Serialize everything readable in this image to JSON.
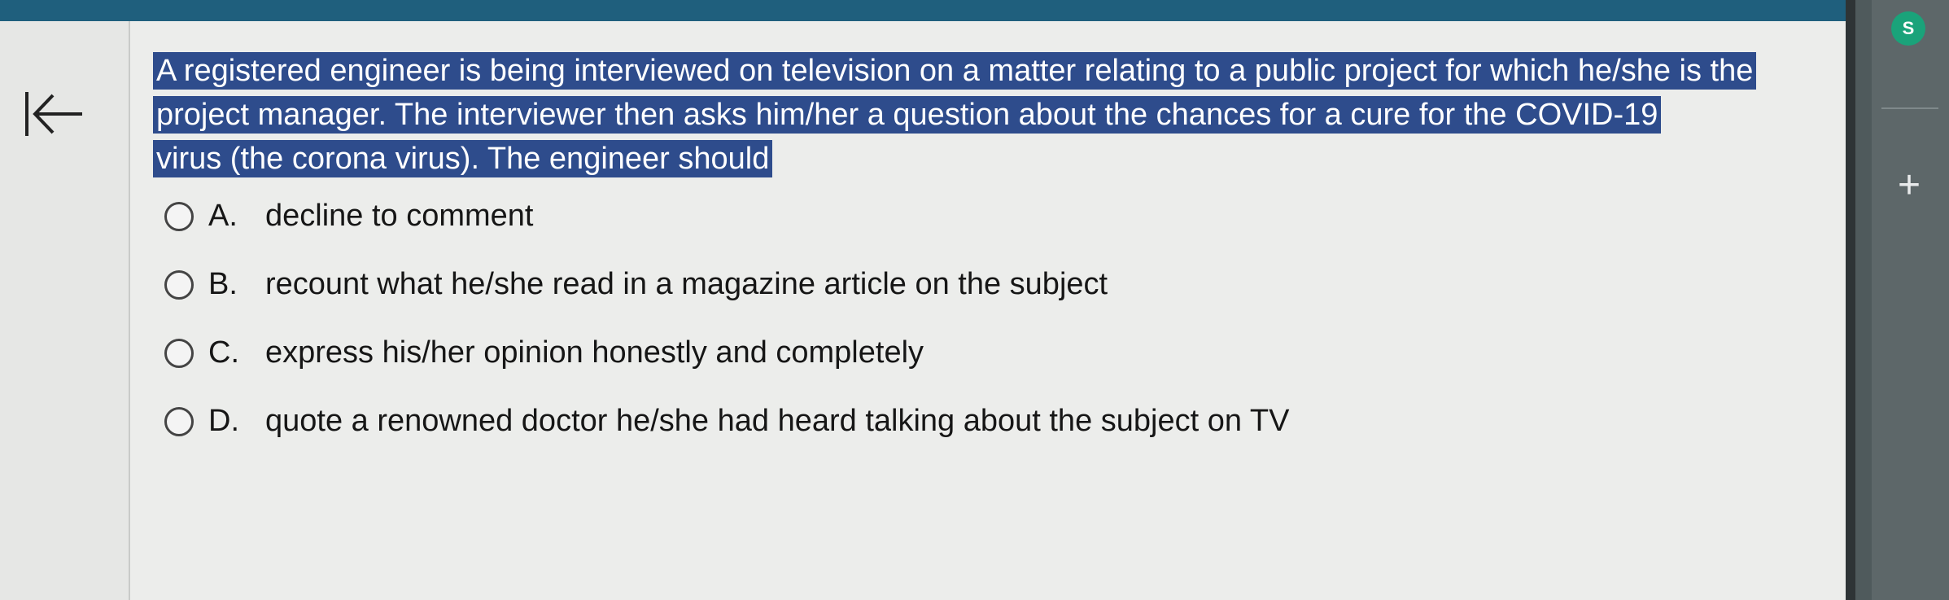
{
  "question": {
    "line1": "A registered engineer is being interviewed on television on a matter relating to a public project for which he/she is the",
    "line2": "project manager. The interviewer then asks him/her a question about the chances for a cure for the COVID-19",
    "line3": "virus (the corona virus). The engineer should"
  },
  "choices": [
    {
      "letter": "A.",
      "text": "decline to comment"
    },
    {
      "letter": "B.",
      "text": "recount what he/she read in a magazine article on the subject"
    },
    {
      "letter": "C.",
      "text": "express his/her opinion honestly and completely"
    },
    {
      "letter": "D.",
      "text": "quote a renowned doctor he/she had heard talking about the subject on TV"
    }
  ],
  "side_panel": {
    "badge": "S",
    "plus": "+"
  },
  "icons": {
    "back": "arrow-to-start-icon",
    "plus": "plus-icon"
  },
  "colors": {
    "highlight": "#2e4c8c",
    "top_bar": "#1f5f7d",
    "badge": "#1aa37a"
  }
}
